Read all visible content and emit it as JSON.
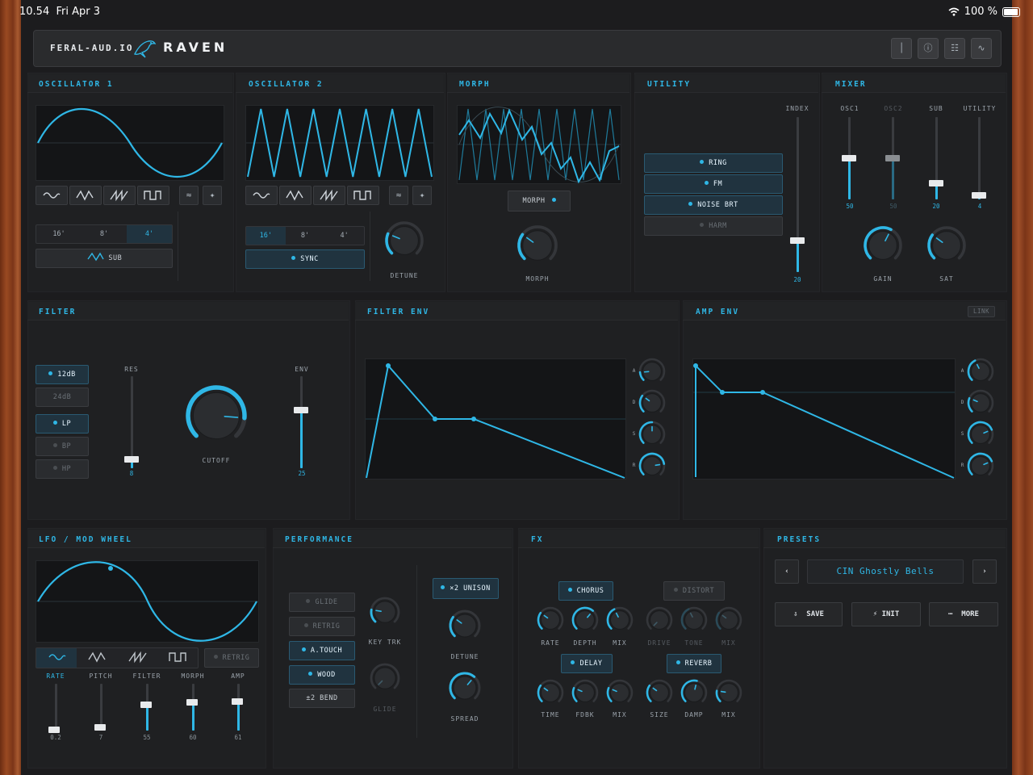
{
  "status": {
    "time": "10.54",
    "date": "Fri Apr 3",
    "battery": "100 %"
  },
  "header": {
    "brand": "FERAL-AUD.IO",
    "product": "RAVEN",
    "icons": [
      "tuning-fork-icon",
      "info-icon",
      "keyboard-icon",
      "pulse-icon"
    ]
  },
  "osc1": {
    "title": "OSCILLATOR 1",
    "octaves": [
      "16'",
      "8'",
      "4'"
    ],
    "selected_octave": "4'",
    "sub_label": "SUB"
  },
  "osc2": {
    "title": "OSCILLATOR 2",
    "octaves": [
      "16'",
      "8'",
      "4'"
    ],
    "selected_octave": "16'",
    "sync_label": "SYNC",
    "detune_label": "DETUNE"
  },
  "morph": {
    "title": "MORPH",
    "button": "MORPH",
    "knob_label": "MORPH"
  },
  "utility": {
    "title": "UTILITY",
    "buttons": [
      "RING",
      "FM",
      "NOISE BRT",
      "HARM"
    ],
    "index_label": "INDEX",
    "index_value": "20"
  },
  "mixer": {
    "title": "MIXER",
    "channels": [
      {
        "name": "OSC1",
        "value": "50",
        "level": 0.5
      },
      {
        "name": "OSC2",
        "value": "50",
        "level": 0.5
      },
      {
        "name": "SUB",
        "value": "20",
        "level": 0.2
      },
      {
        "name": "UTILITY",
        "value": "4",
        "level": 0.04
      }
    ],
    "gain_label": "GAIN",
    "sat_label": "SAT"
  },
  "filter": {
    "title": "FILTER",
    "slopes": [
      "12dB",
      "24dB"
    ],
    "types": [
      "LP",
      "BP",
      "HP"
    ],
    "res_label": "RES",
    "res_value": "8",
    "cutoff_label": "CUTOFF",
    "env_label": "ENV",
    "env_value": "25"
  },
  "filter_env": {
    "title": "FILTER ENV",
    "knobs": [
      "A",
      "D",
      "S",
      "R"
    ]
  },
  "amp_env": {
    "title": "AMP ENV",
    "link": "LINK",
    "knobs": [
      "A",
      "D",
      "S",
      "R"
    ]
  },
  "lfo": {
    "title": "LFO / MOD WHEEL",
    "retrig": "RETRIG",
    "sliders": [
      {
        "name": "RATE",
        "value": "0.2",
        "level": 0.02
      },
      {
        "name": "PITCH",
        "value": "7",
        "level": 0.07
      },
      {
        "name": "FILTER",
        "value": "55",
        "level": 0.55
      },
      {
        "name": "MORPH",
        "value": "60",
        "level": 0.6
      },
      {
        "name": "AMP",
        "value": "61",
        "level": 0.61
      }
    ]
  },
  "performance": {
    "title": "PERFORMANCE",
    "buttons": [
      "GLIDE",
      "RETRIG",
      "A.TOUCH",
      "WOOD",
      "±2 BEND"
    ],
    "keytrk": "KEY TRK",
    "glide": "GLIDE",
    "unison": "×2 UNISON",
    "detune": "DETUNE",
    "spread": "SPREAD"
  },
  "fx": {
    "title": "FX",
    "chorus": "CHORUS",
    "distort": "DISTORT",
    "delay": "DELAY",
    "reverb": "REVERB",
    "chorus_knobs": [
      "RATE",
      "DEPTH",
      "MIX"
    ],
    "distort_knobs": [
      "DRIVE",
      "TONE",
      "MIX"
    ],
    "delay_knobs": [
      "TIME",
      "FDBK",
      "MIX"
    ],
    "reverb_knobs": [
      "SIZE",
      "DAMP",
      "MIX"
    ]
  },
  "presets": {
    "title": "PRESETS",
    "name": "CIN Ghostly Bells",
    "save": "SAVE",
    "init": "INIT",
    "more": "MORE"
  },
  "colors": {
    "accent": "#2fb7e6",
    "panel": "#1f2022",
    "bg": "#1c1c1e"
  }
}
